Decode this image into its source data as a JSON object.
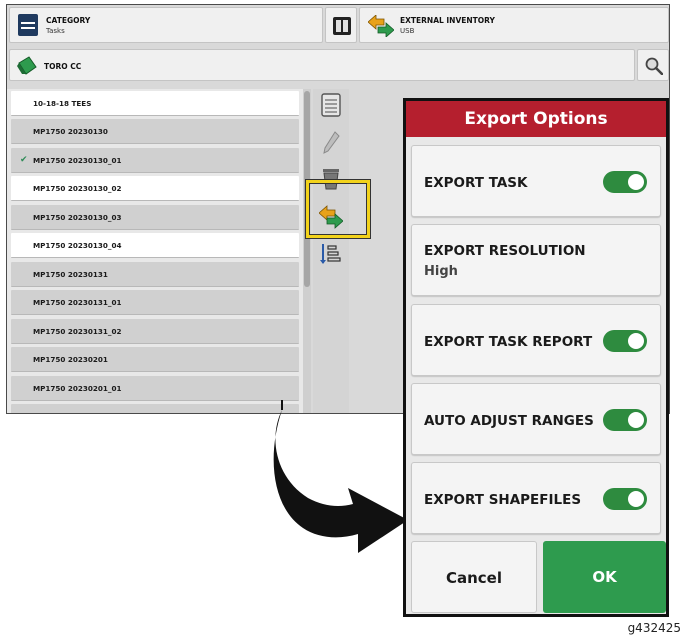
{
  "header": {
    "category_title": "CATEGORY",
    "category_value": "Tasks",
    "inventory_title": "EXTERNAL INVENTORY",
    "inventory_value": "USB",
    "client_label": "TORO CC"
  },
  "task_list": [
    {
      "label": "10-18-18 TEES",
      "state": "white",
      "checked": false
    },
    {
      "label": "MP1750 20230130",
      "state": "grey",
      "checked": false
    },
    {
      "label": "MP1750 20230130_01",
      "state": "grey",
      "checked": true
    },
    {
      "label": "MP1750 20230130_02",
      "state": "white",
      "checked": false
    },
    {
      "label": "MP1750 20230130_03",
      "state": "grey",
      "checked": false
    },
    {
      "label": "MP1750 20230130_04",
      "state": "white",
      "checked": false
    },
    {
      "label": "MP1750 20230131",
      "state": "grey",
      "checked": false
    },
    {
      "label": "MP1750 20230131_01",
      "state": "grey",
      "checked": false
    },
    {
      "label": "MP1750 20230131_02",
      "state": "grey",
      "checked": false
    },
    {
      "label": "MP1750 20230201",
      "state": "grey",
      "checked": false
    },
    {
      "label": "MP1750 20230201_01",
      "state": "grey",
      "checked": false
    }
  ],
  "popup": {
    "title": "Export Options",
    "export_task": {
      "label": "EXPORT TASK",
      "on": true
    },
    "export_resolution": {
      "label": "EXPORT RESOLUTION",
      "value": "High"
    },
    "export_task_report": {
      "label": "EXPORT TASK REPORT",
      "on": true
    },
    "auto_adjust_ranges": {
      "label": "AUTO ADJUST RANGES",
      "on": true
    },
    "export_shapefiles": {
      "label": "EXPORT SHAPEFILES",
      "on": true
    },
    "cancel_label": "Cancel",
    "ok_label": "OK"
  },
  "figure_id": "g432425",
  "colors": {
    "accent_red": "#b51f2e",
    "toggle_green": "#2e8b3f",
    "ok_green": "#2e9b4e",
    "highlight_yellow": "#f2d21b"
  },
  "icons": [
    "category-icon",
    "columns-icon",
    "transfer-icon",
    "client-icon",
    "search-icon",
    "notepad-icon",
    "pencil-icon",
    "trash-icon",
    "export-icon",
    "sort-icon",
    "checkmark-icon",
    "curved-arrow-icon"
  ]
}
